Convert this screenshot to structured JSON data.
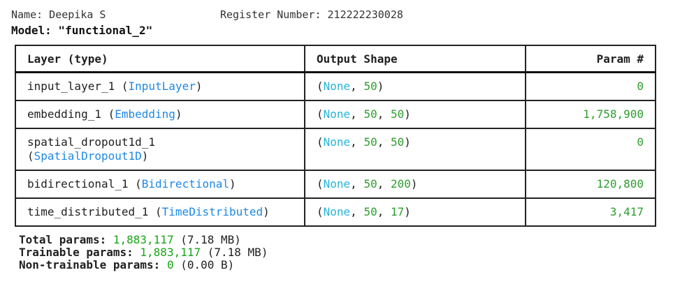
{
  "header": {
    "name_line": "Name: Deepika S",
    "register_line": "Register Number: 212222230028",
    "model_line": "Model: \"functional_2\""
  },
  "table": {
    "columns": [
      "Layer (type)",
      "Output Shape",
      "Param #"
    ],
    "rows": [
      {
        "layer_name": "input_layer_1",
        "layer_type": "InputLayer",
        "shape_none": "None",
        "shape_dims": [
          "50"
        ],
        "params": "0"
      },
      {
        "layer_name": "embedding_1",
        "layer_type": "Embedding",
        "shape_none": "None",
        "shape_dims": [
          "50",
          "50"
        ],
        "params": "1,758,900"
      },
      {
        "layer_name": "spatial_dropout1d_1",
        "layer_type": "SpatialDropout1D",
        "shape_none": "None",
        "shape_dims": [
          "50",
          "50"
        ],
        "params": "0"
      },
      {
        "layer_name": "bidirectional_1",
        "layer_type": "Bidirectional",
        "shape_none": "None",
        "shape_dims": [
          "50",
          "200"
        ],
        "params": "120,800"
      },
      {
        "layer_name": "time_distributed_1",
        "layer_type": "TimeDistributed",
        "shape_none": "None",
        "shape_dims": [
          "50",
          "17"
        ],
        "params": "3,417"
      }
    ]
  },
  "totals": {
    "total_label": "Total params:",
    "total_value": "1,883,117",
    "total_size": "(7.18 MB)",
    "trainable_label": "Trainable params:",
    "trainable_value": "1,883,117",
    "trainable_size": "(7.18 MB)",
    "nontrainable_label": "Non-trainable params:",
    "nontrainable_value": "0",
    "nontrainable_size": "(0.00 B)"
  },
  "colors": {
    "class_name": "#1e88e5",
    "none_keyword": "#26b5d6",
    "number": "#2e9e2e"
  }
}
